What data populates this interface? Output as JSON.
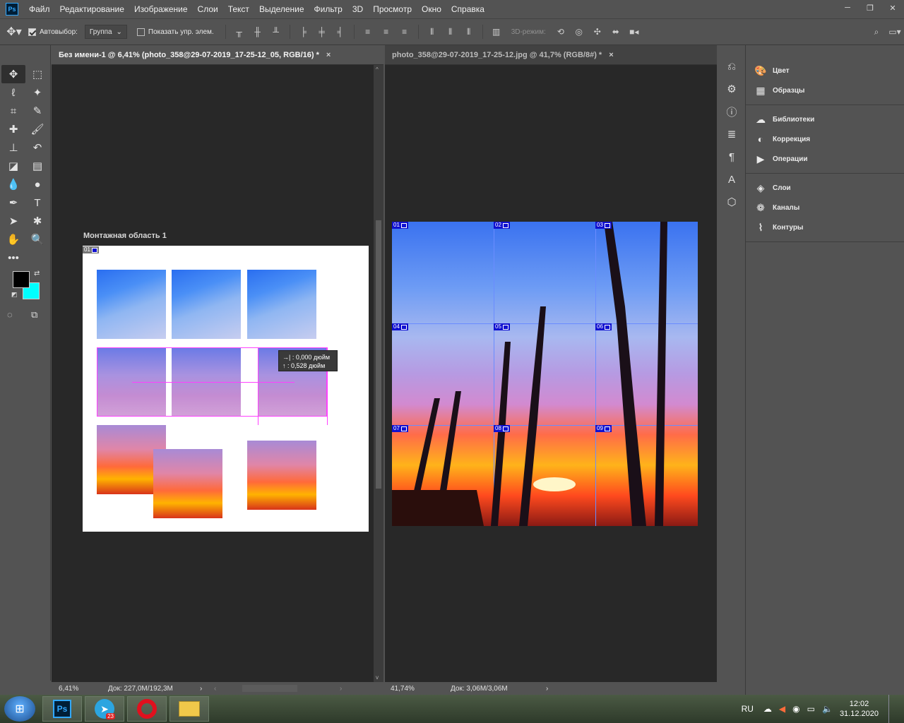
{
  "app": {
    "logo": "Ps"
  },
  "menu": [
    "Файл",
    "Редактирование",
    "Изображение",
    "Слои",
    "Текст",
    "Выделение",
    "Фильтр",
    "3D",
    "Просмотр",
    "Окно",
    "Справка"
  ],
  "options": {
    "autoselect_label": "Автовыбор:",
    "autoselect_value": "Группа",
    "show_transform_label": "Показать упр. элем.",
    "mode3d": "3D-режим:"
  },
  "tabs": {
    "left": {
      "title": "Без имени-1 @ 6,41% (photo_358@29-07-2019_17-25-12_05, RGB/16) *",
      "close": "×"
    },
    "right": {
      "title": "photo_358@29-07-2019_17-25-12.jpg @ 41,7% (RGB/8#) *",
      "close": "×"
    }
  },
  "artboard": {
    "title": "Монтажная область 1",
    "slice": "01"
  },
  "tooltip": {
    "line1_icon": "→|",
    "line1": "0,000 дюйм",
    "line2_icon": "↑",
    "line2": "0,528 дюйм"
  },
  "slices": [
    "01",
    "02",
    "03",
    "04",
    "05",
    "06",
    "07",
    "08",
    "09"
  ],
  "status": {
    "left_zoom": "6,41%",
    "left_doc": "Док: 227,0M/192,3M",
    "right_zoom": "41,74%",
    "right_doc": "Док: 3,06M/3,06M"
  },
  "panels": {
    "group1": [
      {
        "icon": "palette-icon",
        "label": "Цвет"
      },
      {
        "icon": "grid-icon",
        "label": "Образцы"
      }
    ],
    "group2": [
      {
        "icon": "cloud-icon",
        "label": "Библиотеки"
      },
      {
        "icon": "adjust-icon",
        "label": "Коррекция"
      },
      {
        "icon": "play-icon",
        "label": "Операции"
      }
    ],
    "group3": [
      {
        "icon": "layers-icon",
        "label": "Слои"
      },
      {
        "icon": "channels-icon",
        "label": "Каналы"
      },
      {
        "icon": "paths-icon",
        "label": "Контуры"
      }
    ]
  },
  "taskbar": {
    "telegram_badge": "23",
    "lang": "RU",
    "time": "12:02",
    "date": "31.12.2020"
  },
  "colors": {
    "foreground": "#000000",
    "background": "#00ffff",
    "slice_blue": "#1010d0",
    "guide_magenta": "#ff40ff"
  }
}
